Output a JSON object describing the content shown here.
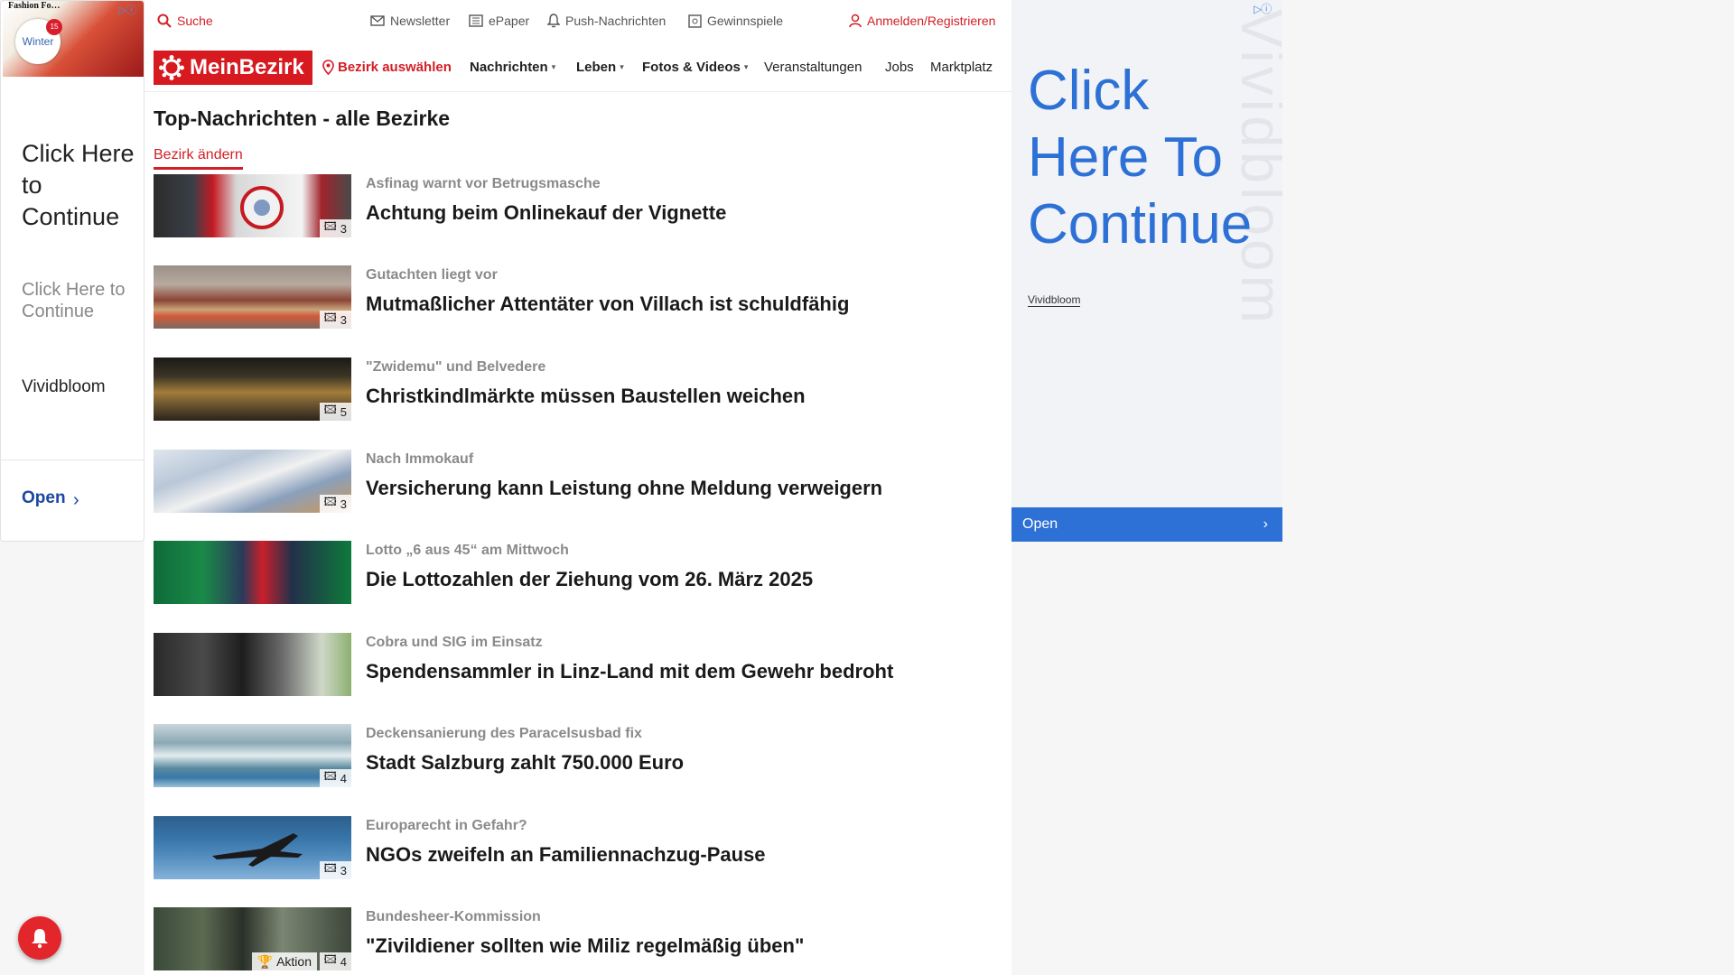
{
  "left_ad": {
    "brand": "Fashion Fo…",
    "badge_text": "Winter",
    "sticker": "15",
    "headline": "Click Here to Continue",
    "subline": "Click Here to Continue",
    "sponsor": "Vividbloom",
    "cta": "Open",
    "adchoices": "▷ⓘ"
  },
  "utility_bar": {
    "search": "Suche",
    "newsletter": "Newsletter",
    "epaper": "ePaper",
    "push": "Push-Nachrichten",
    "games": "Gewinnspiele",
    "login": "Anmelden/Registrieren"
  },
  "nav": {
    "logo": "MeinBezirk",
    "district": "Bezirk auswählen",
    "items": [
      "Nachrichten",
      "Leben",
      "Fotos & Videos",
      "Veranstaltungen",
      "Jobs",
      "Marktplatz"
    ]
  },
  "page": {
    "heading": "Top-Nachrichten - alle Bezirke",
    "change_district": "Bezirk ändern"
  },
  "articles": [
    {
      "kicker": "Asfinag warnt vor Betrugsmasche",
      "title": "Achtung beim Onlinekauf der Vignette",
      "photos": "3"
    },
    {
      "kicker": "Gutachten liegt vor",
      "title": "Mutmaßlicher Attentäter von Villach ist schuldfähig",
      "photos": "3"
    },
    {
      "kicker": "\"Zwidemu\" und Belvedere",
      "title": "Christkindlmärkte müssen Baustellen weichen",
      "photos": "5"
    },
    {
      "kicker": "Nach Immokauf",
      "title": "Versicherung kann Leistung ohne Meldung verweigern",
      "photos": "3"
    },
    {
      "kicker": "Lotto „6 aus 45“ am Mittwoch",
      "title": "Die Lottozahlen der Ziehung vom 26. März 2025",
      "photos": ""
    },
    {
      "kicker": "Cobra und SIG im Einsatz",
      "title": "Spendensammler in Linz-Land mit dem Gewehr bedroht",
      "photos": ""
    },
    {
      "kicker": "Deckensanierung des Paracelsusbad fix",
      "title": "Stadt Salzburg zahlt 750.000 Euro",
      "photos": "4"
    },
    {
      "kicker": "Europarecht in Gefahr?",
      "title": "NGOs zweifeln an Familiennachzug-Pause",
      "photos": "3"
    },
    {
      "kicker": "Bundesheer-Kommission",
      "title": "\"Zivildiener sollten wie Miliz regelmäßig üben\"",
      "photos": "4",
      "extra_badge": "Aktion"
    }
  ],
  "right_ad": {
    "watermark": "Vividbloom",
    "headline": "Click Here To Continue",
    "sponsor": "Vividbloom",
    "cta": "Open",
    "adchoices": "▷ⓘ"
  },
  "colors": {
    "brand_red": "#d71920",
    "ad_blue": "#2d71d6",
    "kicker_gray": "#8a8a8a"
  }
}
